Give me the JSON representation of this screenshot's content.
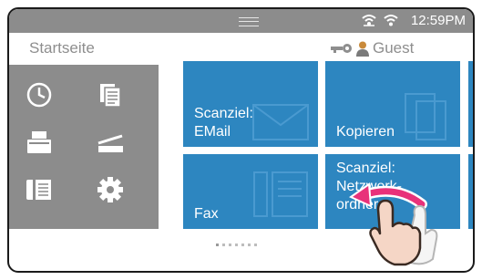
{
  "status": {
    "time": "12:59PM",
    "icons": [
      "network-icon",
      "wifi-icon"
    ]
  },
  "header": {
    "title": "Startseite",
    "user_label": "Guest",
    "icons": [
      "key-icon",
      "user-icon"
    ]
  },
  "sidebar": {
    "icons": [
      "job-status-icon",
      "copy-docs-icon",
      "printer-icon",
      "scanner-icon",
      "fax-phone-icon",
      "settings-gear-icon"
    ]
  },
  "tiles": [
    {
      "label_line1": "Scanziel:",
      "label_line2": "EMail"
    },
    {
      "label_line1": "Kopieren",
      "label_line2": ""
    },
    {
      "label_line1": "Fax",
      "label_line2": ""
    },
    {
      "label_line1": "Scanziel:",
      "label_line2": "Netzwerk-",
      "label_line3": "ordner"
    }
  ],
  "pager": {
    "pages": 7,
    "current": 1
  },
  "gesture": {
    "name": "swipe-left-gesture",
    "colors": {
      "arrow": "#e8327a",
      "hand": "#f5d6c6"
    }
  },
  "colors": {
    "tile": "#2d86c0",
    "panel": "#8c8c8c",
    "status_bar": "#8c8c8c"
  }
}
